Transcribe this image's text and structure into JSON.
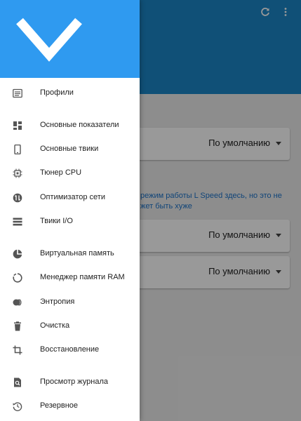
{
  "toolbar": {
    "refresh_icon": "refresh-icon",
    "more_icon": "more-vert-icon"
  },
  "content": {
    "dropdowns": [
      {
        "value": "По умолчанию"
      },
      {
        "value": "По умолчанию"
      },
      {
        "value": "По умолчанию"
      }
    ],
    "info_line1": "режим работы L Speed здесь, но это не",
    "info_line2": "жет быть хуже"
  },
  "drawer": {
    "header_icon": "chevron-down-icon",
    "items": [
      {
        "label": "Профили",
        "icon": "list-icon"
      },
      {
        "label": "Основные показатели",
        "icon": "dashboard-icon"
      },
      {
        "label": "Основные твики",
        "icon": "phone-icon"
      },
      {
        "label": "Тюнер CPU",
        "icon": "chip-icon"
      },
      {
        "label": "Оптимизатор сети",
        "icon": "network-icon"
      },
      {
        "label": "Твики I/O",
        "icon": "storage-icon"
      },
      {
        "label": "Виртуальная память",
        "icon": "pie-icon"
      },
      {
        "label": "Менеджер памяти RAM",
        "icon": "ring-icon"
      },
      {
        "label": "Энтропия",
        "icon": "circles-icon"
      },
      {
        "label": "Очистка",
        "icon": "trash-icon"
      },
      {
        "label": "Восстановление",
        "icon": "crop-icon"
      },
      {
        "label": "Просмотр журнала",
        "icon": "log-search-icon"
      },
      {
        "label": "Резервное",
        "icon": "backup-icon"
      }
    ]
  },
  "colors": {
    "toolbar": "#1c85c7",
    "drawer_header": "#2f9af0",
    "link": "#1b72c9"
  }
}
